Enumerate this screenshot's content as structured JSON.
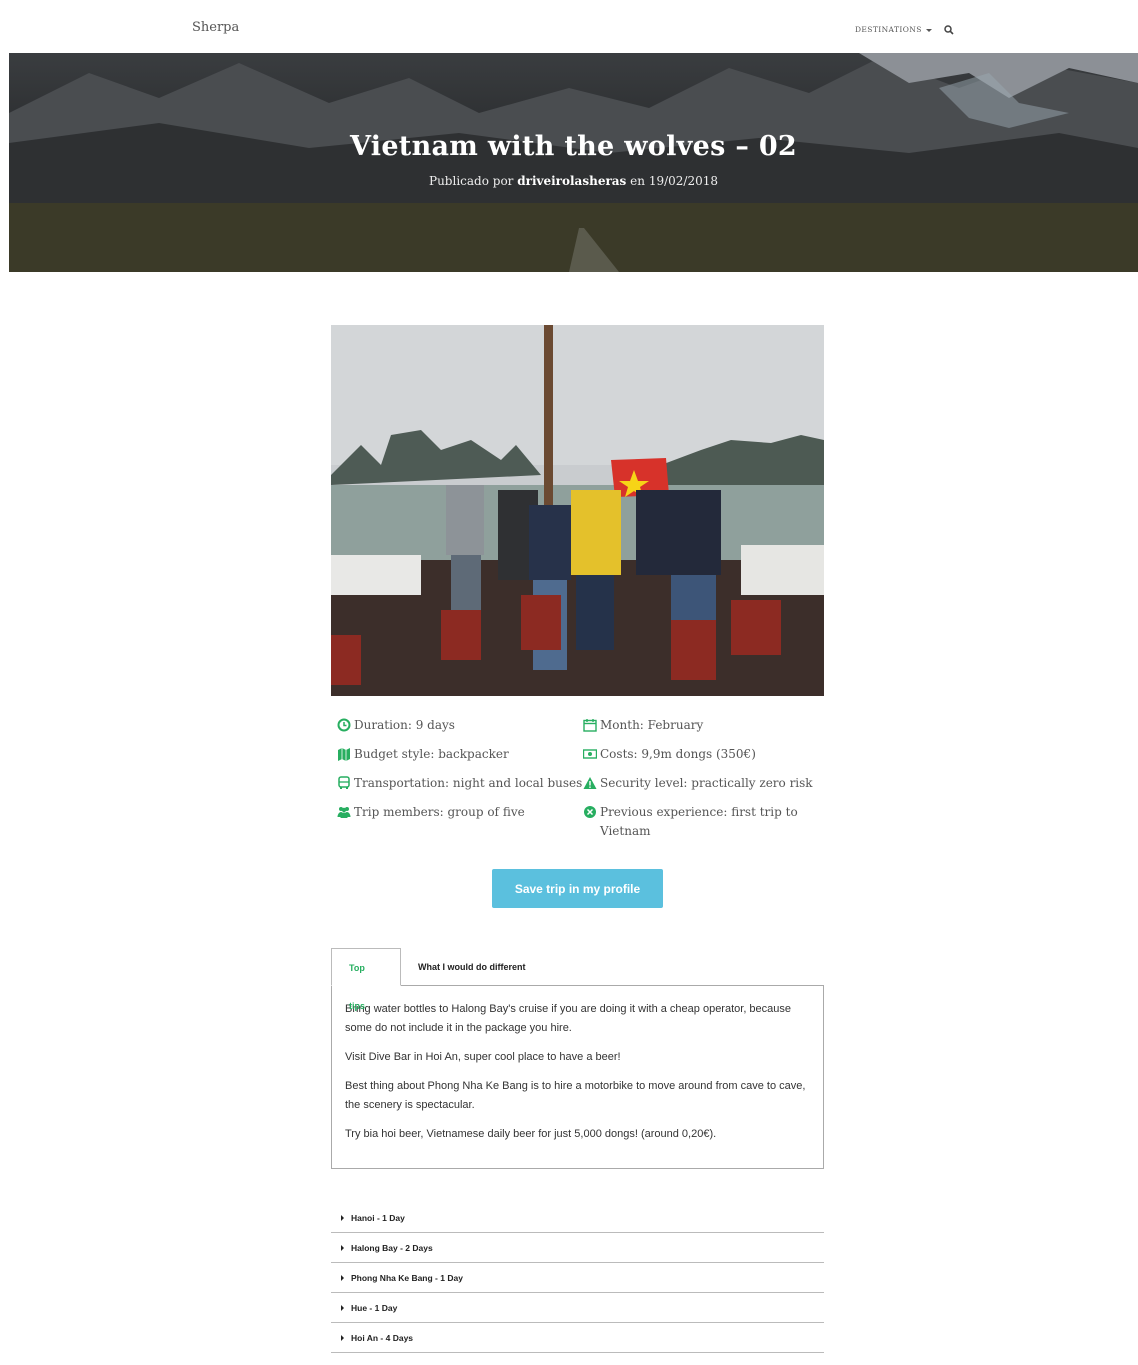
{
  "nav": {
    "brand": "Sherpa",
    "destinations_label": "DESTINATIONS",
    "search_icon": "search-icon"
  },
  "hero": {
    "title": "Vietnam with the wolves – 02",
    "published_prefix": "Publicado por",
    "author": "driveirolasheras",
    "date_prefix": "en",
    "date": "19/02/2018"
  },
  "info": {
    "duration": "Duration: 9 days",
    "month": "Month: February",
    "budget": "Budget style: backpacker",
    "costs": "Costs: 9,9m dongs (350€)",
    "transport": "Transportation: night and local buses",
    "security": "Security level: practically zero risk",
    "members": "Trip members: group of five",
    "experience": "Previous experience: first trip to Vietnam",
    "accent_color": "#27ae60"
  },
  "save_button": "Save trip in my profile",
  "tabs": [
    {
      "label": "Top tips",
      "active": true
    },
    {
      "label": "What I would do different",
      "active": false
    }
  ],
  "tips": [
    "Bring water bottles to Halong Bay's cruise if you are doing it with a cheap operator, because some do not include it in the package you hire.",
    "Visit Dive Bar in Hoi An, super cool place to have a beer!",
    "Best thing about Phong Nha Ke Bang is to hire a motorbike to move around from cave to cave, the scenery is spectacular.",
    "Try bia hoi beer, Vietnamese daily beer for just 5,000 dongs! (around 0,20€)."
  ],
  "itinerary": [
    "Hanoi - 1 Day",
    "Halong Bay - 2 Days",
    "Phong Nha Ke Bang - 1 Day",
    "Hue - 1 Day",
    "Hoi An - 4 Days"
  ]
}
